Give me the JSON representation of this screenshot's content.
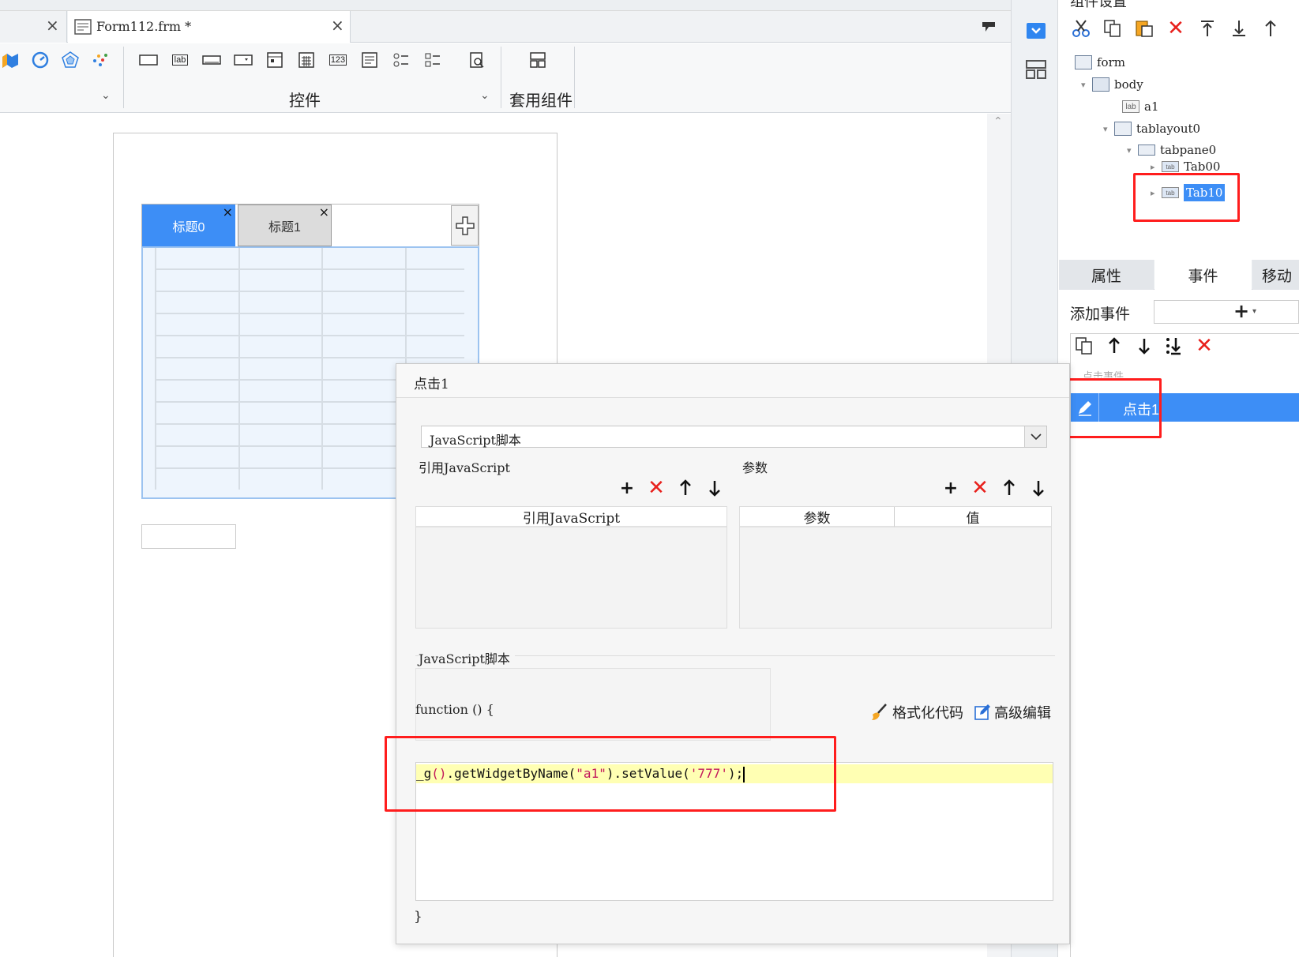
{
  "top_tabs": {
    "form_tab_label": "Form112.frm *"
  },
  "ribbon": {
    "controls_label": "控件",
    "common_components_label": "套用组件",
    "label_icon_text": "lab",
    "number_icon_text": "123"
  },
  "right_panel": {
    "title_partial": "组件设置",
    "tree": {
      "form": "form",
      "body": "body",
      "a1": "a1",
      "tablayout0": "tablayout0",
      "tabpane0": "tabpane0",
      "tab00": "Tab00",
      "tab10": "Tab10",
      "lab_icon": "lab",
      "tab_icon": "tab"
    },
    "tabs": {
      "properties": "属性",
      "events": "事件",
      "mobile": "移动"
    },
    "add_event_label": "添加事件",
    "event_group_label": "点击事件",
    "event_item": "点击1"
  },
  "canvas": {
    "tab_title_0": "标题0",
    "tab_title_1": "标题1"
  },
  "dialog": {
    "title": "点击1",
    "script_type": "JavaScript脚本",
    "ref_js_section": "引用JavaScript",
    "params_section": "参数",
    "ref_js_column": "引用JavaScript",
    "param_column": "参数",
    "value_column": "值",
    "script_section": "JavaScript脚本",
    "function_open": "function () {",
    "function_close": "}",
    "format_code": "格式化代码",
    "advanced_edit": "高级编辑",
    "code_line": {
      "p1": "_g",
      "p2": "()",
      "p3": ".getWidgetByName(",
      "p4": "\"a1\"",
      "p5": ").setValue(",
      "p6": "'777'",
      "p7": ");"
    }
  },
  "colors": {
    "selected_blue": "#3d8ef6",
    "highlight_red": "#ff1d1d",
    "code_line_bg": "#ffffb3",
    "string_color": "#c2185b"
  }
}
